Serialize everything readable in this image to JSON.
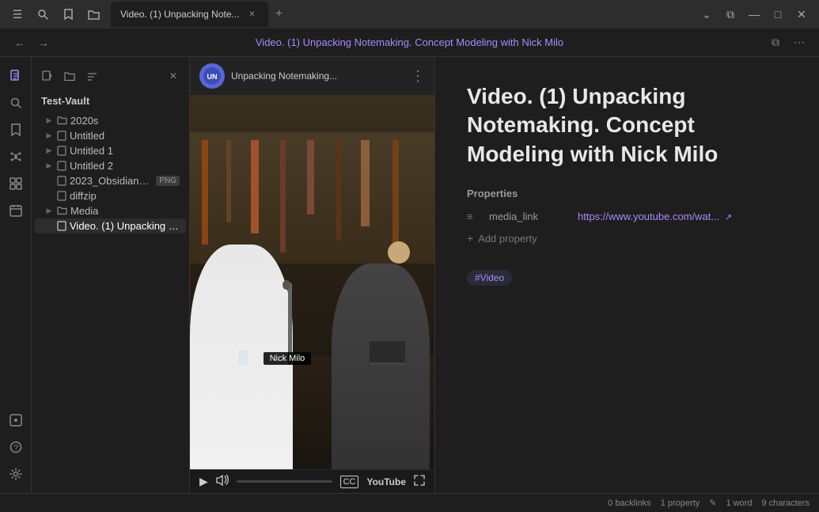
{
  "titlebar": {
    "sidebar_toggle_label": "☰",
    "search_label": "🔍",
    "bookmark_label": "🔖",
    "folder_label": "📁",
    "tab_title": "Video. (1) Unpacking Note...",
    "tab_add": "+",
    "chevron_down": "⌄",
    "split_view": "⧉",
    "minimize": "—",
    "maximize": "□",
    "close": "✕"
  },
  "navbar": {
    "back": "←",
    "forward": "→",
    "title": "Video. (1) Unpacking Notemaking. Concept Modeling with Nick Milo",
    "split": "⧉",
    "more": "⋯"
  },
  "sidebar": {
    "icons": [
      {
        "name": "files-icon",
        "glyph": "📄"
      },
      {
        "name": "search-icon",
        "glyph": "🔍"
      },
      {
        "name": "bookmarks-icon",
        "glyph": "🔖"
      },
      {
        "name": "graph-icon",
        "glyph": "⬡"
      },
      {
        "name": "blocks-icon",
        "glyph": "⊞"
      },
      {
        "name": "calendar-icon",
        "glyph": "📅"
      }
    ],
    "bottom_icons": [
      {
        "name": "inbox-icon",
        "glyph": "📥"
      },
      {
        "name": "help-icon",
        "glyph": "?"
      },
      {
        "name": "settings-icon",
        "glyph": "⚙"
      }
    ]
  },
  "filetree": {
    "toolbar": {
      "new_note": "✎",
      "new_folder": "📁",
      "sort": "↕",
      "close": "✕"
    },
    "vault_name": "Test-Vault",
    "items": [
      {
        "id": "2020s",
        "label": "2020s",
        "type": "folder",
        "indent": 0
      },
      {
        "id": "untitled",
        "label": "Untitled",
        "type": "file",
        "indent": 0
      },
      {
        "id": "untitled1",
        "label": "Untitled 1",
        "type": "file",
        "indent": 0
      },
      {
        "id": "untitled2",
        "label": "Untitled 2",
        "type": "file",
        "indent": 0
      },
      {
        "id": "obsidian-logo",
        "label": "2023_Obsidian_lo...",
        "type": "file",
        "badge": "PNG",
        "indent": 0
      },
      {
        "id": "diffzip",
        "label": "diffzip",
        "type": "file",
        "indent": 0
      },
      {
        "id": "media",
        "label": "Media",
        "type": "folder",
        "indent": 0
      },
      {
        "id": "video-note",
        "label": "Video. (1) Unpacking N...",
        "type": "file",
        "indent": 0,
        "active": true
      }
    ]
  },
  "video": {
    "channel_icon_text": "UN",
    "title": "Unpacking Notemaking...",
    "more_btn": "⋮",
    "nameplate": "Nick Milo",
    "play_btn": "▶",
    "volume_btn": "🔊",
    "cc_btn": "CC",
    "yt_btn": "YouTube",
    "fullscreen_btn": "⛶"
  },
  "note": {
    "title": "Video. (1) Unpacking Notemaking. Concept Modeling with Nick Milo",
    "properties_heading": "Properties",
    "prop_icon": "≡",
    "prop_key": "media_link",
    "prop_value": "https://www.youtube.com/wat...",
    "prop_external_icon": "↗",
    "add_prop_icon": "+",
    "add_prop_label": "Add property",
    "tag": "#Video"
  },
  "statusbar": {
    "backlinks": "0 backlinks",
    "property": "1 property",
    "edit_icon": "✎",
    "word_count": "1 word",
    "char_count": "9 characters"
  }
}
